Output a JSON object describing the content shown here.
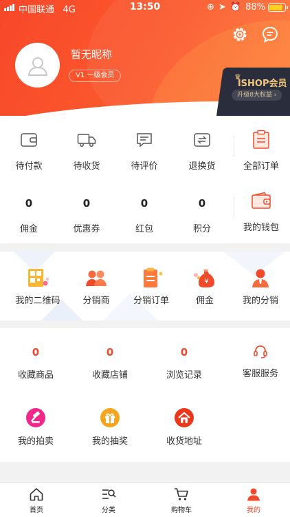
{
  "status_bar": {
    "carrier": "中国联通",
    "network": "4G",
    "time": "13:50",
    "battery": "88%"
  },
  "profile": {
    "nickname": "暂无昵称",
    "member_level": "V1 一级会员"
  },
  "ishop": {
    "title": "ISHOP会员",
    "upgrade": "升级8大权益"
  },
  "orders": {
    "items": [
      {
        "label": "待付款",
        "icon": "wallet-icon"
      },
      {
        "label": "待收货",
        "icon": "truck-icon"
      },
      {
        "label": "待评价",
        "icon": "comment-icon"
      },
      {
        "label": "退换货",
        "icon": "return-icon"
      }
    ],
    "all_label": "全部订单"
  },
  "assets": {
    "items": [
      {
        "value": "0",
        "label": "佣金"
      },
      {
        "value": "0",
        "label": "优惠券"
      },
      {
        "value": "0",
        "label": "红包"
      },
      {
        "value": "0",
        "label": "积分"
      }
    ],
    "wallet_label": "我的钱包"
  },
  "distribution": {
    "items": [
      {
        "label": "我的二维码",
        "icon": "qrcode-icon"
      },
      {
        "label": "分销商",
        "icon": "distributor-icon"
      },
      {
        "label": "分销订单",
        "icon": "distribution-order-icon"
      },
      {
        "label": "佣金",
        "icon": "money-bag-icon"
      },
      {
        "label": "我的分销",
        "icon": "my-distribution-icon"
      }
    ]
  },
  "favorites": {
    "items": [
      {
        "value": "0",
        "label": "收藏商品"
      },
      {
        "value": "0",
        "label": "收藏店铺"
      },
      {
        "value": "0",
        "label": "浏览记录"
      }
    ],
    "service_label": "客服服务"
  },
  "services": {
    "items": [
      {
        "label": "我的拍卖",
        "icon": "auction-icon"
      },
      {
        "label": "我的抽奖",
        "icon": "gift-icon"
      },
      {
        "label": "收货地址",
        "icon": "home-icon"
      }
    ]
  },
  "tabbar": {
    "items": [
      {
        "label": "首页",
        "icon": "home-tab-icon"
      },
      {
        "label": "分类",
        "icon": "category-icon"
      },
      {
        "label": "购物车",
        "icon": "cart-icon"
      },
      {
        "label": "我的",
        "icon": "user-icon"
      }
    ],
    "active_index": 3
  },
  "colors": {
    "accent": "#f04a2b",
    "header_start": "#f8472a",
    "header_end": "#ff7a3a",
    "ishop_bg": "#2a2e3c",
    "ishop_gold": "#f2c57c"
  }
}
